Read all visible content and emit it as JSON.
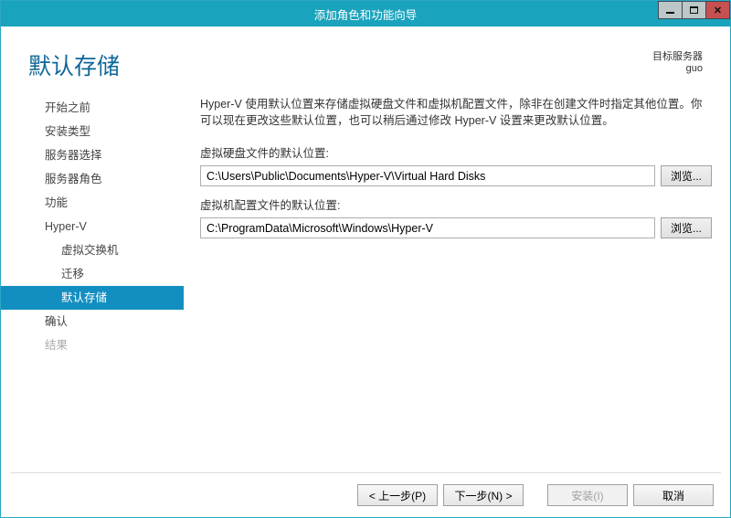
{
  "window": {
    "title": "添加角色和功能向导"
  },
  "header": {
    "page_title": "默认存储",
    "target_label": "目标服务器",
    "target_value": "guo"
  },
  "sidebar": {
    "items": [
      {
        "label": "开始之前"
      },
      {
        "label": "安装类型"
      },
      {
        "label": "服务器选择"
      },
      {
        "label": "服务器角色"
      },
      {
        "label": "功能"
      },
      {
        "label": "Hyper-V"
      },
      {
        "label": "虚拟交换机"
      },
      {
        "label": "迁移"
      },
      {
        "label": "默认存储"
      },
      {
        "label": "确认"
      },
      {
        "label": "结果"
      }
    ]
  },
  "main": {
    "description": "Hyper-V 使用默认位置来存储虚拟硬盘文件和虚拟机配置文件，除非在创建文件时指定其他位置。你可以现在更改这些默认位置，也可以稍后通过修改 Hyper-V 设置来更改默认位置。",
    "vhd_label": "虚拟硬盘文件的默认位置:",
    "vhd_path": "C:\\Users\\Public\\Documents\\Hyper-V\\Virtual Hard Disks",
    "config_label": "虚拟机配置文件的默认位置:",
    "config_path": "C:\\ProgramData\\Microsoft\\Windows\\Hyper-V",
    "browse_label": "浏览..."
  },
  "footer": {
    "prev": "< 上一步(P)",
    "next": "下一步(N) >",
    "install": "安装(I)",
    "cancel": "取消"
  }
}
